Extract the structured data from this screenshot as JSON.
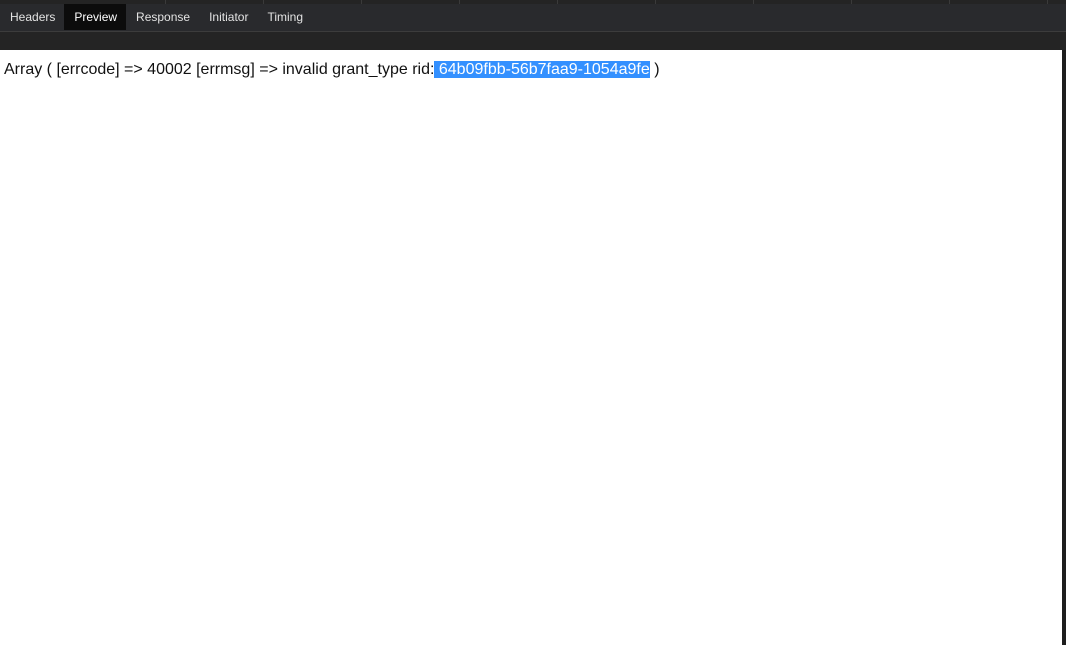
{
  "devtools": {
    "tabs": [
      {
        "label": "Headers",
        "active": false
      },
      {
        "label": "Preview",
        "active": true
      },
      {
        "label": "Response",
        "active": false
      },
      {
        "label": "Initiator",
        "active": false
      },
      {
        "label": "Timing",
        "active": false
      }
    ]
  },
  "preview": {
    "text_before": "Array ( [errcode] => 40002 [errmsg] => invalid grant_type rid:",
    "text_selected": " 64b09fbb-56b7faa9-1054a9fe",
    "text_after": " )"
  },
  "colors": {
    "panel_background": "#242424",
    "tab_bar": "#292a2d",
    "active_tab": "#0c0c0c",
    "selection_highlight": "#3390ff",
    "preview_background": "#ffffff"
  }
}
